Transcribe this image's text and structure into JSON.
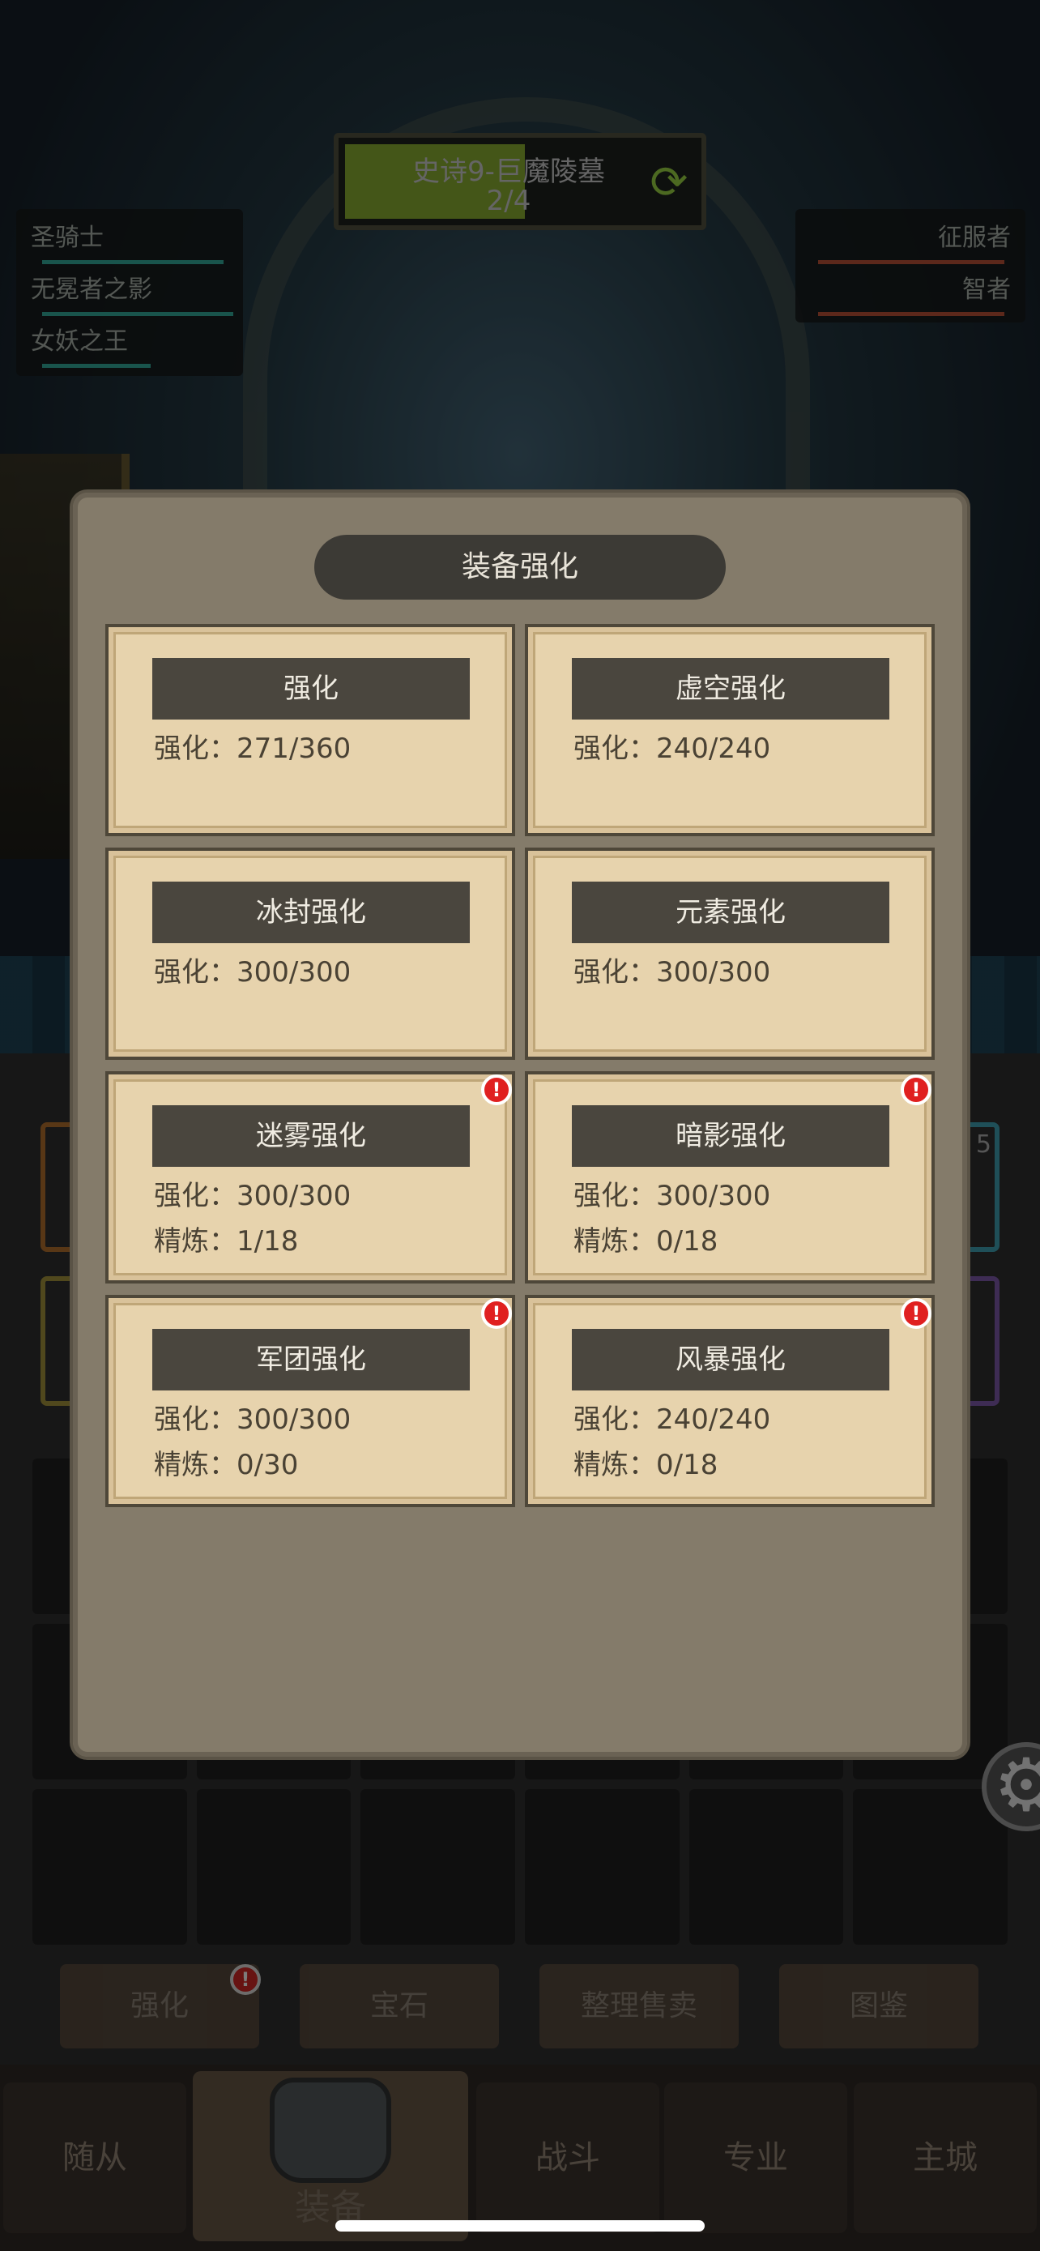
{
  "stage": {
    "title": "史诗9-巨魔陵墓",
    "progress_text": "2/4",
    "progress_fraction": 0.5,
    "refresh_icon": "refresh-icon"
  },
  "left_roster": [
    {
      "name": "圣骑士"
    },
    {
      "name": "无冕者之影"
    },
    {
      "name": "女妖之王"
    }
  ],
  "right_roster": [
    {
      "name": "征服者"
    },
    {
      "name": "智者"
    }
  ],
  "modal": {
    "title": "装备强化",
    "cards": [
      {
        "title": "强化",
        "line1": "强化：271/360",
        "line2": "",
        "alert": false
      },
      {
        "title": "虚空强化",
        "line1": "强化：240/240",
        "line2": "",
        "alert": false
      },
      {
        "title": "冰封强化",
        "line1": "强化：300/300",
        "line2": "",
        "alert": false
      },
      {
        "title": "元素强化",
        "line1": "强化：300/300",
        "line2": "",
        "alert": false
      },
      {
        "title": "迷雾强化",
        "line1": "强化：300/300",
        "line2": "精炼：1/18",
        "alert": true
      },
      {
        "title": "暗影强化",
        "line1": "强化：300/300",
        "line2": "精炼：0/18",
        "alert": true
      },
      {
        "title": "军团强化",
        "line1": "强化：300/300",
        "line2": "精炼：0/30",
        "alert": true
      },
      {
        "title": "风暴强化",
        "line1": "强化：240/240",
        "line2": "精炼：0/18",
        "alert": true
      }
    ]
  },
  "alert_glyph": "!",
  "sub_tabs": [
    "强化",
    "宝石",
    "整理售卖",
    "图鉴"
  ],
  "nav": {
    "left": [
      "随从"
    ],
    "active": "装备",
    "right": [
      "战斗",
      "专业",
      "主城"
    ]
  },
  "slot_number": "5",
  "colors": {
    "modal_bg": "#847b6a",
    "card_bg": "#e7d3ad",
    "header_bg": "#4a463e",
    "alert": "#e02020"
  }
}
